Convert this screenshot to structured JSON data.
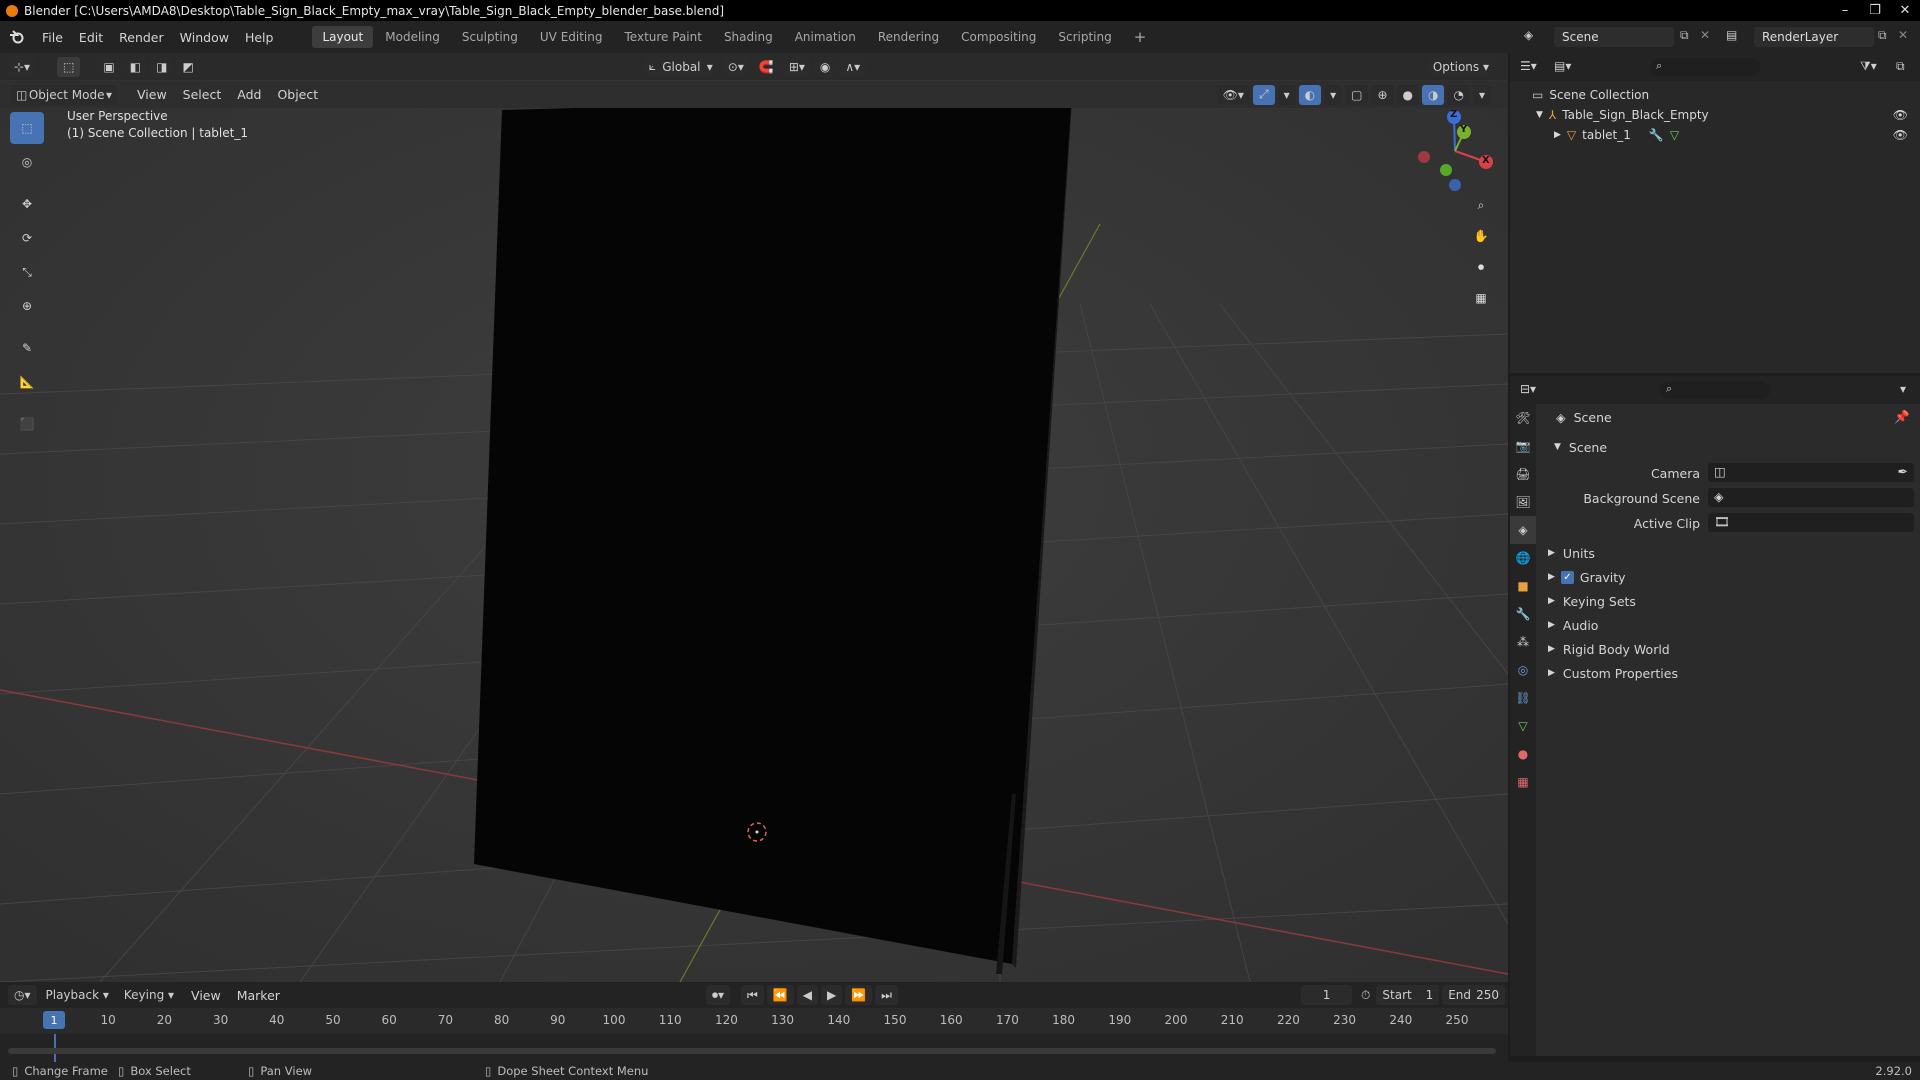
{
  "window": {
    "title": "Blender [C:\\Users\\AMDA8\\Desktop\\Table_Sign_Black_Empty_max_vray\\Table_Sign_Black_Empty_blender_base.blend]",
    "controls": [
      "–",
      "❐",
      "✕"
    ]
  },
  "menu": [
    "File",
    "Edit",
    "Render",
    "Window",
    "Help"
  ],
  "workspaces": [
    "Layout",
    "Modeling",
    "Sculpting",
    "UV Editing",
    "Texture Paint",
    "Shading",
    "Animation",
    "Rendering",
    "Compositing",
    "Scripting"
  ],
  "add_workspace": "+",
  "scene_field": "Scene",
  "layer_field": "RenderLayer",
  "viewport": {
    "transform_orientation": "Global",
    "options": "Options",
    "mode": "Object Mode",
    "header_menus": [
      "View",
      "Select",
      "Add",
      "Object"
    ],
    "overlay_title": "User Perspective",
    "overlay_sub": "(1) Scene Collection | tablet_1",
    "gizmo": {
      "z": "Z",
      "y": "Y",
      "x": "X"
    }
  },
  "outliner": {
    "root": "Scene Collection",
    "items": [
      {
        "label": "Table_Sign_Black_Empty"
      },
      {
        "label": "tablet_1"
      }
    ]
  },
  "properties": {
    "context": "Scene",
    "section": "Scene",
    "fields": [
      {
        "label": "Camera"
      },
      {
        "label": "Background Scene"
      },
      {
        "label": "Active Clip"
      }
    ],
    "panels": [
      "Units",
      "Gravity",
      "Keying Sets",
      "Audio",
      "Rigid Body World",
      "Custom Properties"
    ]
  },
  "timeline": {
    "menus": [
      "Playback",
      "Keying",
      "View",
      "Marker"
    ],
    "current_frame": "1",
    "start_label": "Start",
    "start": "1",
    "end_label": "End",
    "end": "250",
    "ticks": [
      "10",
      "20",
      "30",
      "40",
      "50",
      "60",
      "70",
      "80",
      "90",
      "100",
      "110",
      "120",
      "130",
      "140",
      "150",
      "160",
      "170",
      "180",
      "190",
      "200",
      "210",
      "220",
      "230",
      "240",
      "250"
    ],
    "playhead": "1"
  },
  "status": {
    "items": [
      "Change Frame",
      "Box Select",
      "Pan View",
      "Dope Sheet Context Menu"
    ],
    "version": "2.92.0"
  }
}
